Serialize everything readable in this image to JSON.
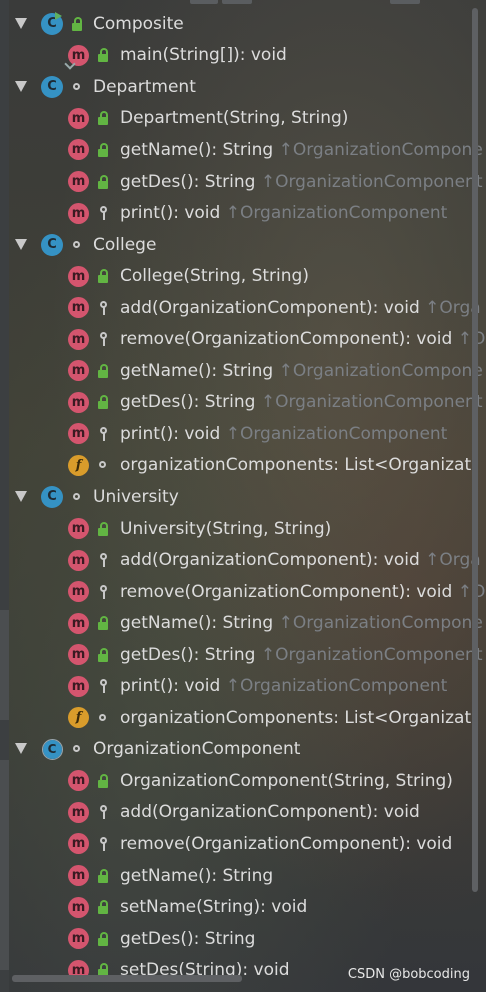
{
  "tree": [
    {
      "type": "class",
      "kind": "runnable",
      "name": "Composite",
      "vis": "public",
      "level": 0,
      "expanded": true
    },
    {
      "type": "method",
      "name": "main(String[]): void",
      "vis": "public",
      "level": 1,
      "inherit": "",
      "small_arrow": true
    },
    {
      "type": "class",
      "kind": "class",
      "name": "Department",
      "vis": "package",
      "level": 0,
      "expanded": true
    },
    {
      "type": "method",
      "name": "Department(String, String)",
      "vis": "public",
      "level": 1,
      "inherit": ""
    },
    {
      "type": "method",
      "name": "getName(): String ",
      "vis": "public",
      "level": 1,
      "inherit": "↑OrganizationCompone"
    },
    {
      "type": "method",
      "name": "getDes(): String ",
      "vis": "public",
      "level": 1,
      "inherit": "↑OrganizationComponent"
    },
    {
      "type": "method",
      "name": "print(): void ",
      "vis": "protected",
      "level": 1,
      "inherit": "↑OrganizationComponent"
    },
    {
      "type": "class",
      "kind": "class",
      "name": "College",
      "vis": "package",
      "level": 0,
      "expanded": true
    },
    {
      "type": "method",
      "name": "College(String, String)",
      "vis": "public",
      "level": 1,
      "inherit": ""
    },
    {
      "type": "method",
      "name": "add(OrganizationComponent): void ",
      "vis": "protected",
      "level": 1,
      "inherit": "↑Orga"
    },
    {
      "type": "method",
      "name": "remove(OrganizationComponent): void ",
      "vis": "protected",
      "level": 1,
      "inherit": "↑O"
    },
    {
      "type": "method",
      "name": "getName(): String ",
      "vis": "public",
      "level": 1,
      "inherit": "↑OrganizationCompone"
    },
    {
      "type": "method",
      "name": "getDes(): String ",
      "vis": "public",
      "level": 1,
      "inherit": "↑OrganizationComponent"
    },
    {
      "type": "method",
      "name": "print(): void ",
      "vis": "protected",
      "level": 1,
      "inherit": "↑OrganizationComponent"
    },
    {
      "type": "field",
      "name": "organizationComponents: List<Organizati",
      "vis": "package",
      "level": 1,
      "inherit": ""
    },
    {
      "type": "class",
      "kind": "class",
      "name": "University",
      "vis": "package",
      "level": 0,
      "expanded": true
    },
    {
      "type": "method",
      "name": "University(String, String)",
      "vis": "public",
      "level": 1,
      "inherit": ""
    },
    {
      "type": "method",
      "name": "add(OrganizationComponent): void ",
      "vis": "protected",
      "level": 1,
      "inherit": "↑Orga"
    },
    {
      "type": "method",
      "name": "remove(OrganizationComponent): void ",
      "vis": "protected",
      "level": 1,
      "inherit": "↑O"
    },
    {
      "type": "method",
      "name": "getName(): String ",
      "vis": "public",
      "level": 1,
      "inherit": "↑OrganizationCompone"
    },
    {
      "type": "method",
      "name": "getDes(): String ",
      "vis": "public",
      "level": 1,
      "inherit": "↑OrganizationComponent"
    },
    {
      "type": "method",
      "name": "print(): void ",
      "vis": "protected",
      "level": 1,
      "inherit": "↑OrganizationComponent"
    },
    {
      "type": "field",
      "name": "organizationComponents: List<Organizati",
      "vis": "package",
      "level": 1,
      "inherit": ""
    },
    {
      "type": "class",
      "kind": "abstract",
      "name": "OrganizationComponent",
      "vis": "package",
      "level": 0,
      "expanded": true
    },
    {
      "type": "method",
      "name": "OrganizationComponent(String, String)",
      "vis": "public",
      "level": 1,
      "inherit": ""
    },
    {
      "type": "method",
      "name": "add(OrganizationComponent): void",
      "vis": "protected",
      "level": 1,
      "inherit": ""
    },
    {
      "type": "method",
      "name": "remove(OrganizationComponent): void",
      "vis": "protected",
      "level": 1,
      "inherit": ""
    },
    {
      "type": "method",
      "name": "getName(): String",
      "vis": "public",
      "level": 1,
      "inherit": ""
    },
    {
      "type": "method",
      "name": "setName(String): void",
      "vis": "public",
      "level": 1,
      "inherit": ""
    },
    {
      "type": "method",
      "name": "getDes(): String",
      "vis": "public",
      "level": 1,
      "inherit": ""
    },
    {
      "type": "method",
      "name": "setDes(String): void",
      "vis": "public",
      "level": 1,
      "inherit": ""
    }
  ],
  "icons": {
    "class_letter": "C",
    "method_letter": "m",
    "field_letter": "f"
  },
  "colors": {
    "class_icon": "#3592c4",
    "method_icon": "#d4556e",
    "field_icon": "#d99c2b",
    "public_lock": "#62b543",
    "inherited_text": "#7b7f84"
  },
  "watermark": "CSDN @bobcoding"
}
